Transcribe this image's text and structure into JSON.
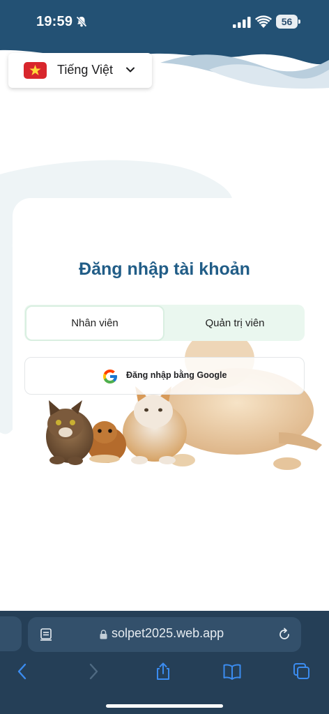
{
  "status_bar": {
    "time": "19:59",
    "battery_level": "56",
    "icons": [
      "bell-slash-icon",
      "cellular-signal-icon",
      "wifi-icon",
      "battery-icon"
    ]
  },
  "language_selector": {
    "label": "Tiếng Việt",
    "flag_icon": "vietnam-flag-icon",
    "chevron_icon": "chevron-down-icon"
  },
  "login": {
    "title": "Đăng nhập tài khoản",
    "tabs": [
      {
        "label": "Nhân viên",
        "selected": true
      },
      {
        "label": "Quản trị viên",
        "selected": false
      }
    ],
    "google_button": {
      "label": "Đăng nhập bằng Google",
      "icon": "google-icon"
    }
  },
  "browser": {
    "url": "solpet2025.web.app",
    "toolbar_icons": [
      "back-arrow-icon",
      "forward-arrow-icon",
      "share-icon",
      "bookmarks-icon",
      "tabs-icon"
    ]
  },
  "colors": {
    "header": "#2a5a82",
    "title": "#215d87",
    "tab_bg": "#eaf7ef",
    "browser_bar": "#253f57",
    "browser_accent": "#3b8cf0"
  }
}
